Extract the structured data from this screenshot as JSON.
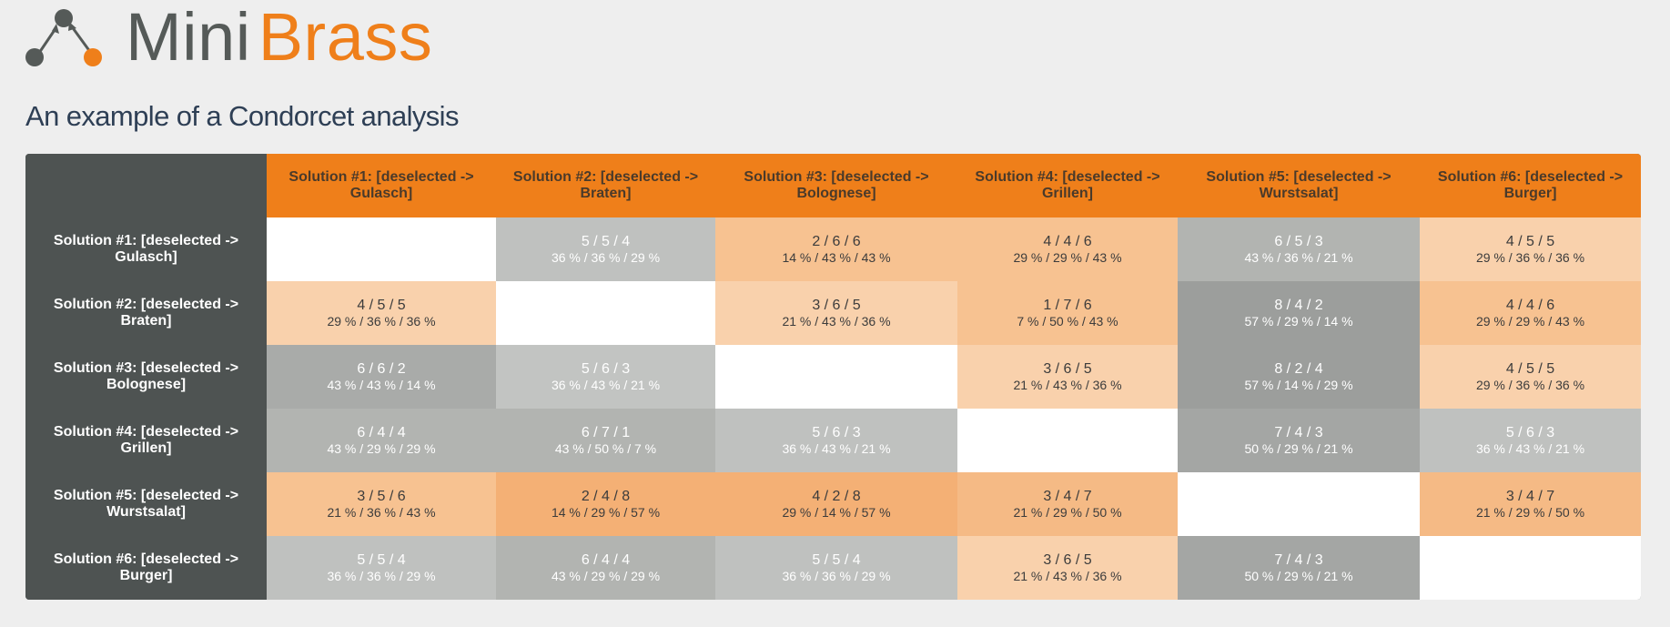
{
  "brand": {
    "mini": "Mini",
    "brass": "Brass"
  },
  "subtitle": "An example of a Condorcet analysis",
  "colors": {
    "accent": "#ef7f1a",
    "sidebar": "#4e5352",
    "background": "#eeeeee"
  },
  "columns": [
    "Solution #1: [deselected -> Gulasch]",
    "Solution #2: [deselected -> Braten]",
    "Solution #3: [deselected -> Bolognese]",
    "Solution #4: [deselected -> Grillen]",
    "Solution #5: [deselected -> Wurstsalat]",
    "Solution #6: [deselected -> Burger]"
  ],
  "rows": [
    {
      "label": "Solution #1: [deselected -> Gulasch]",
      "cells": [
        null,
        {
          "counts": "5 / 5 / 4",
          "pcts": "36 % / 36 % / 29 %",
          "bg": "#bfc1bf",
          "tone": "dark"
        },
        {
          "counts": "2 / 6 / 6",
          "pcts": "14 % / 43 % / 43 %",
          "bg": "#f7c291",
          "tone": "light"
        },
        {
          "counts": "4 / 4 / 6",
          "pcts": "29 % / 29 % / 43 %",
          "bg": "#f7c291",
          "tone": "light"
        },
        {
          "counts": "6 / 5 / 3",
          "pcts": "43 % / 36 % / 21 %",
          "bg": "#b2b4b1",
          "tone": "dark"
        },
        {
          "counts": "4 / 5 / 5",
          "pcts": "29 % / 36 % / 36 %",
          "bg": "#f9d1ac",
          "tone": "light"
        }
      ]
    },
    {
      "label": "Solution #2: [deselected -> Braten]",
      "cells": [
        {
          "counts": "4 / 5 / 5",
          "pcts": "29 % / 36 % / 36 %",
          "bg": "#f9d1ac",
          "tone": "light"
        },
        null,
        {
          "counts": "3 / 6 / 5",
          "pcts": "21 % / 43 % / 36 %",
          "bg": "#f9d1ac",
          "tone": "light"
        },
        {
          "counts": "1 / 7 / 6",
          "pcts": "7 % / 50 % / 43 %",
          "bg": "#f7c291",
          "tone": "light"
        },
        {
          "counts": "8 / 4 / 2",
          "pcts": "57 % / 29 % / 14 %",
          "bg": "#9c9e9c",
          "tone": "dark"
        },
        {
          "counts": "4 / 4 / 6",
          "pcts": "29 % / 29 % / 43 %",
          "bg": "#f7c291",
          "tone": "light"
        }
      ]
    },
    {
      "label": "Solution #3: [deselected -> Bolognese]",
      "cells": [
        {
          "counts": "6 / 6 / 2",
          "pcts": "43 % / 43 % / 14 %",
          "bg": "#a9aba9",
          "tone": "dark"
        },
        {
          "counts": "5 / 6 / 3",
          "pcts": "36 % / 43 % / 21 %",
          "bg": "#c2c4c2",
          "tone": "dark"
        },
        null,
        {
          "counts": "3 / 6 / 5",
          "pcts": "21 % / 43 % / 36 %",
          "bg": "#f9d1ac",
          "tone": "light"
        },
        {
          "counts": "8 / 2 / 4",
          "pcts": "57 % / 14 % / 29 %",
          "bg": "#9c9e9c",
          "tone": "dark"
        },
        {
          "counts": "4 / 5 / 5",
          "pcts": "29 % / 36 % / 36 %",
          "bg": "#f9d1ac",
          "tone": "light"
        }
      ]
    },
    {
      "label": "Solution #4: [deselected -> Grillen]",
      "cells": [
        {
          "counts": "6 / 4 / 4",
          "pcts": "43 % / 29 % / 29 %",
          "bg": "#b2b4b1",
          "tone": "dark"
        },
        {
          "counts": "6 / 7 / 1",
          "pcts": "43 % / 50 % / 7 %",
          "bg": "#b2b4b1",
          "tone": "dark"
        },
        {
          "counts": "5 / 6 / 3",
          "pcts": "36 % / 43 % / 21 %",
          "bg": "#bfc1bf",
          "tone": "dark"
        },
        null,
        {
          "counts": "7 / 4 / 3",
          "pcts": "50 % / 29 % / 21 %",
          "bg": "#a4a6a4",
          "tone": "dark"
        },
        {
          "counts": "5 / 6 / 3",
          "pcts": "36 % / 43 % / 21 %",
          "bg": "#bfc1bf",
          "tone": "dark"
        }
      ]
    },
    {
      "label": "Solution #5: [deselected -> Wurstsalat]",
      "cells": [
        {
          "counts": "3 / 5 / 6",
          "pcts": "21 % / 36 % / 43 %",
          "bg": "#f7c291",
          "tone": "light"
        },
        {
          "counts": "2 / 4 / 8",
          "pcts": "14 % / 29 % / 57 %",
          "bg": "#f4b075",
          "tone": "light"
        },
        {
          "counts": "4 / 2 / 8",
          "pcts": "29 % / 14 % / 57 %",
          "bg": "#f4b075",
          "tone": "light"
        },
        {
          "counts": "3 / 4 / 7",
          "pcts": "21 % / 29 % / 50 %",
          "bg": "#f5ba85",
          "tone": "light"
        },
        null,
        {
          "counts": "3 / 4 / 7",
          "pcts": "21 % / 29 % / 50 %",
          "bg": "#f5ba85",
          "tone": "light"
        }
      ]
    },
    {
      "label": "Solution #6: [deselected -> Burger]",
      "cells": [
        {
          "counts": "5 / 5 / 4",
          "pcts": "36 % / 36 % / 29 %",
          "bg": "#bfc1bf",
          "tone": "dark"
        },
        {
          "counts": "6 / 4 / 4",
          "pcts": "43 % / 29 % / 29 %",
          "bg": "#b2b4b1",
          "tone": "dark"
        },
        {
          "counts": "5 / 5 / 4",
          "pcts": "36 % / 36 % / 29 %",
          "bg": "#bfc1bf",
          "tone": "dark"
        },
        {
          "counts": "3 / 6 / 5",
          "pcts": "21 % / 43 % / 36 %",
          "bg": "#f9d1ac",
          "tone": "light"
        },
        {
          "counts": "7 / 4 / 3",
          "pcts": "50 % / 29 % / 21 %",
          "bg": "#a4a6a4",
          "tone": "dark"
        },
        null
      ]
    }
  ]
}
